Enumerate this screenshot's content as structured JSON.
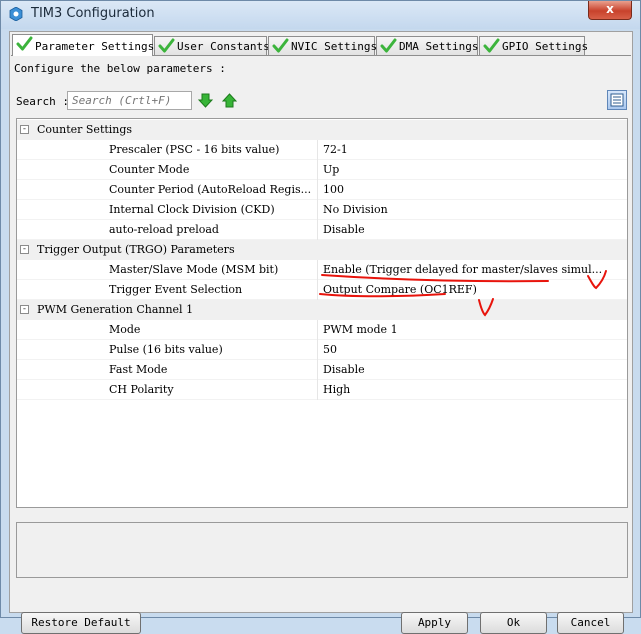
{
  "window": {
    "title": "TIM3 Configuration",
    "close_label": "x"
  },
  "tabs": [
    {
      "label": "Parameter Settings",
      "active": true
    },
    {
      "label": "User Constants",
      "active": false
    },
    {
      "label": "NVIC Settings",
      "active": false
    },
    {
      "label": "DMA Settings",
      "active": false
    },
    {
      "label": "GPIO Settings",
      "active": false
    }
  ],
  "configure_label": "Configure the below parameters :",
  "search": {
    "label": "Search :",
    "placeholder": "Search (Crtl+F)"
  },
  "groups": [
    {
      "name": "Counter Settings",
      "toggle": "-",
      "params": [
        {
          "name": "Prescaler (PSC - 16 bits value)",
          "value": "72-1"
        },
        {
          "name": "Counter Mode",
          "value": "Up"
        },
        {
          "name": "Counter Period (AutoReload Regis...",
          "value": "100"
        },
        {
          "name": "Internal Clock Division (CKD)",
          "value": "No Division"
        },
        {
          "name": "auto-reload preload",
          "value": "Disable"
        }
      ]
    },
    {
      "name": "Trigger Output (TRGO) Parameters",
      "toggle": "-",
      "params": [
        {
          "name": "Master/Slave Mode (MSM bit)",
          "value": "Enable (Trigger delayed for master/slaves simul..."
        },
        {
          "name": "Trigger Event Selection",
          "value": "Output Compare (OC1REF)"
        }
      ]
    },
    {
      "name": "PWM Generation Channel 1",
      "toggle": "-",
      "params": [
        {
          "name": "Mode",
          "value": "PWM mode 1"
        },
        {
          "name": "Pulse (16 bits value)",
          "value": "50"
        },
        {
          "name": "Fast Mode",
          "value": "Disable"
        },
        {
          "name": "CH Polarity",
          "value": "High"
        }
      ]
    }
  ],
  "buttons": {
    "restore": "Restore Default",
    "apply": "Apply",
    "ok": "Ok",
    "cancel": "Cancel"
  },
  "colors": {
    "annotation": "#e8140c",
    "check": "#3cb43c",
    "arrow": "#2da52d",
    "title_bg": "#c8dbee"
  },
  "icons": {
    "title": "gear-icon",
    "tab": "check-icon",
    "expand": "arrow-down-icon",
    "collapse": "arrow-up-icon",
    "view": "list-view-icon"
  }
}
